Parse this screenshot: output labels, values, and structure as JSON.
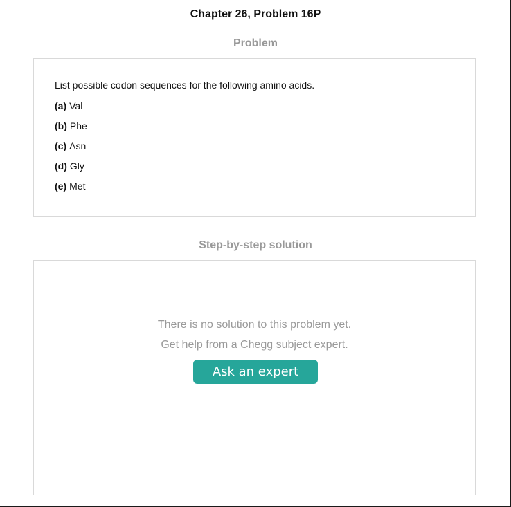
{
  "header": {
    "chapter_title": "Chapter 26, Problem 16P"
  },
  "problem": {
    "heading": "Problem",
    "intro": "List possible codon sequences for the following amino acids.",
    "parts": [
      {
        "label": "(a)",
        "text": "Val"
      },
      {
        "label": "(b)",
        "text": "Phe"
      },
      {
        "label": "(c)",
        "text": "Asn"
      },
      {
        "label": "(d)",
        "text": "Gly"
      },
      {
        "label": "(e)",
        "text": "Met"
      }
    ]
  },
  "solution": {
    "heading": "Step-by-step solution",
    "no_solution_line1": "There is no solution to this problem yet.",
    "no_solution_line2": "Get help from a Chegg subject expert.",
    "ask_button_label": "Ask an expert",
    "ask_button_color": "#26a69a"
  }
}
